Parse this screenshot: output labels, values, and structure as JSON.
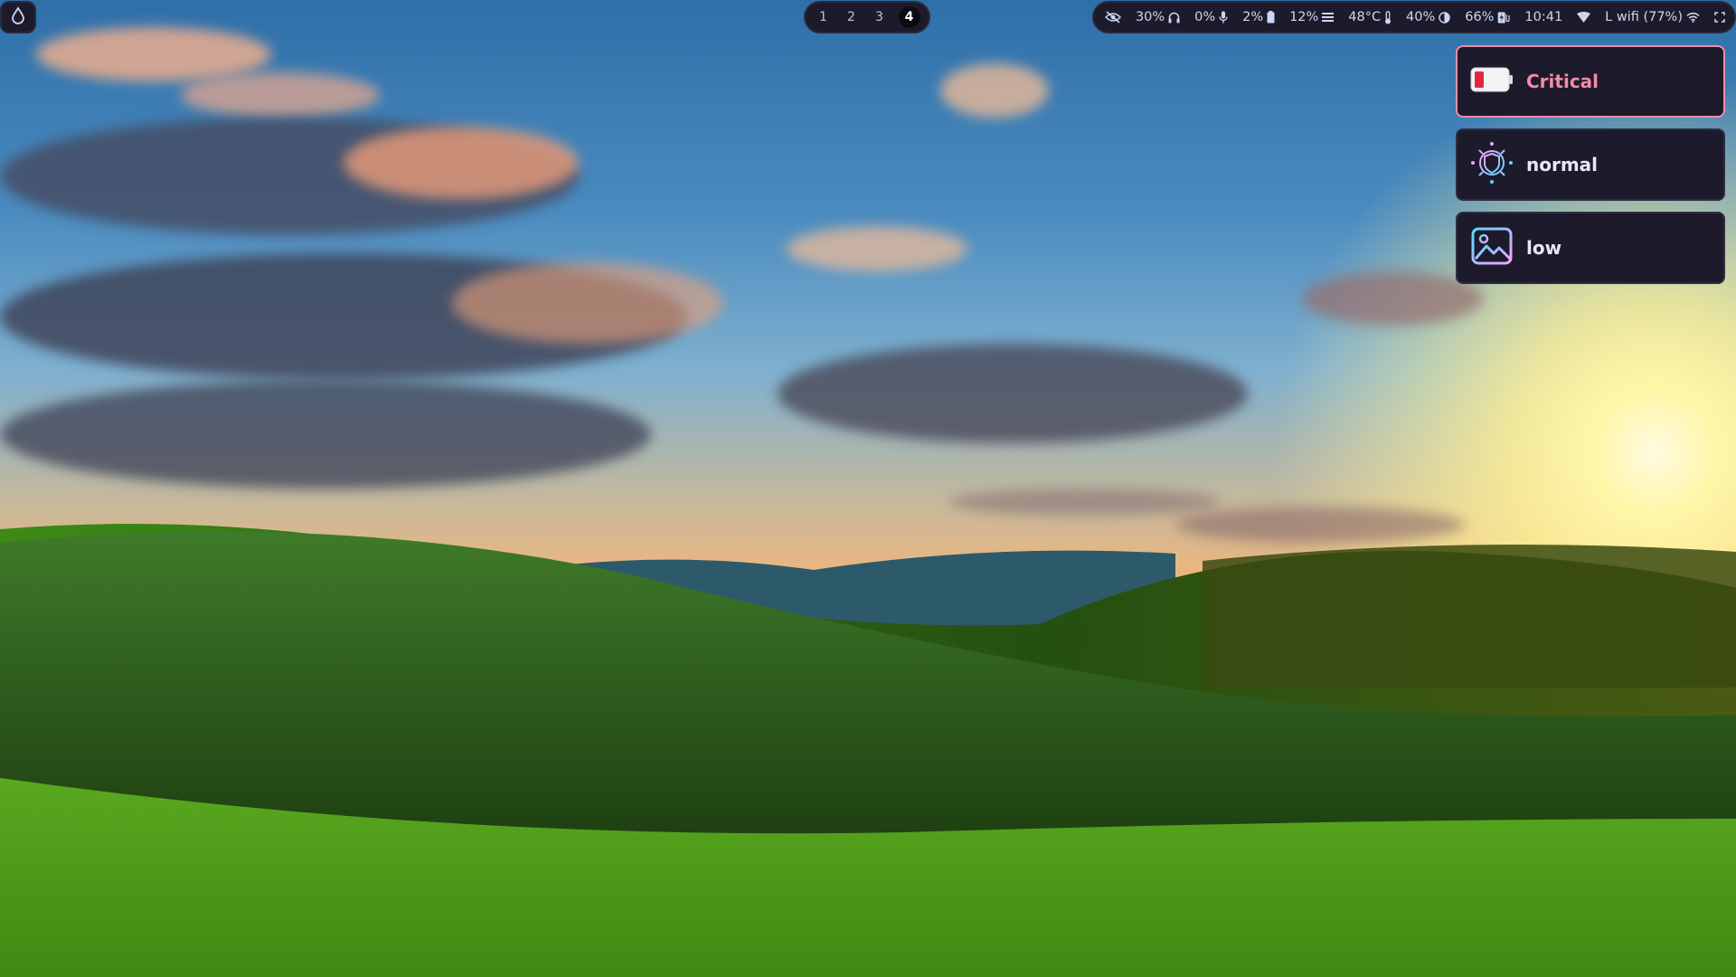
{
  "launcher": {
    "icon": "droplet-icon"
  },
  "workspaces": [
    {
      "label": "1",
      "active": false
    },
    {
      "label": "2",
      "active": false
    },
    {
      "label": "3",
      "active": false
    },
    {
      "label": "4",
      "active": true
    }
  ],
  "status": {
    "idle_inhibitor_icon": "eye-off-icon",
    "volume": "30%",
    "volume_icon": "headphones-icon",
    "mic": "0%",
    "mic_icon": "microphone-icon",
    "cpu": "2%",
    "cpu_icon": "battery-icon",
    "memory": "12%",
    "memory_icon": "menu-icon",
    "temperature": "48°C",
    "temperature_icon": "thermometer-icon",
    "backlight": "40%",
    "backlight_icon": "half-circle-icon",
    "battery": "66%",
    "battery_icon": "battery-charging-icon",
    "clock": "10:41",
    "wifi_icon": "wifi-icon",
    "network": "L wifi (77%)",
    "network_icon": "wifi-icon",
    "power_icon": "power-icon"
  },
  "notifications": [
    {
      "label": "Critical",
      "urgency": "critical",
      "icon": "battery-low-icon"
    },
    {
      "label": "normal",
      "urgency": "normal",
      "icon": "vpn-shield-icon"
    },
    {
      "label": "low",
      "urgency": "low",
      "icon": "image-icon"
    }
  ],
  "colors": {
    "bar_bg": "#1d1b2b",
    "text": "#cdd6f4",
    "critical": "#f38ba8",
    "accent_gradient": [
      "#f5a3ff",
      "#5bd6ff"
    ]
  }
}
